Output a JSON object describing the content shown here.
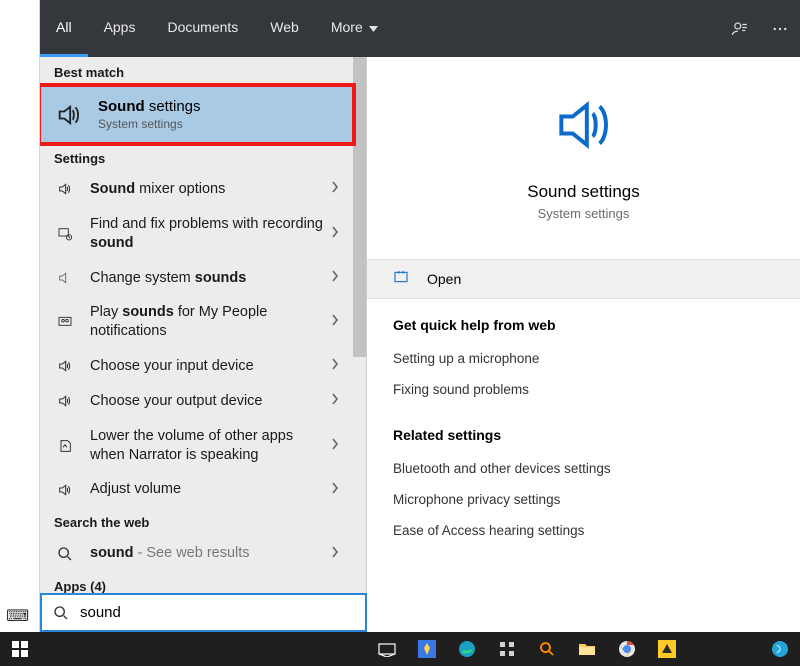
{
  "tabs": [
    "All",
    "Apps",
    "Documents",
    "Web",
    "More"
  ],
  "activeTab": "All",
  "bestMatchHeader": "Best match",
  "bestMatch": {
    "title_pre": "Sound",
    "title_post": " settings",
    "sub": "System settings"
  },
  "settingsHeader": "Settings",
  "settingsRows": [
    {
      "icon": "speaker",
      "html": "<b>Sound</b> mixer options"
    },
    {
      "icon": "troubleshoot",
      "html": "Find and fix problems with recording <b>sound</b>"
    },
    {
      "icon": "speaker-muted",
      "html": "Change system <b>sounds</b>"
    },
    {
      "icon": "people",
      "html": "Play <b>sounds</b> for My People notifications"
    },
    {
      "icon": "speaker",
      "html": "Choose your input device"
    },
    {
      "icon": "speaker",
      "html": "Choose your output device"
    },
    {
      "icon": "narrator",
      "html": "Lower the volume of other apps when Narrator is speaking"
    },
    {
      "icon": "speaker",
      "html": "Adjust volume"
    }
  ],
  "searchWebHeader": "Search the web",
  "webRow": {
    "query": "sound",
    "suffix": " - See web results"
  },
  "appsHeader": "Apps (4)",
  "searchBox": {
    "value": "sound"
  },
  "rightPane": {
    "title": "Sound settings",
    "sub": "System settings",
    "open": "Open",
    "quickHelpHeader": "Get quick help from web",
    "quickHelp": [
      "Setting up a microphone",
      "Fixing sound problems"
    ],
    "relatedHeader": "Related settings",
    "related": [
      "Bluetooth and other devices settings",
      "Microphone privacy settings",
      "Ease of Access hearing settings"
    ]
  }
}
